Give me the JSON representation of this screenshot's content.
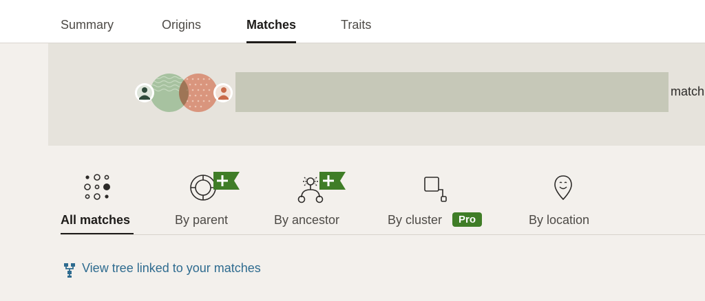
{
  "topnav": {
    "tabs": [
      {
        "label": "Summary"
      },
      {
        "label": "Origins"
      },
      {
        "label": "Matches"
      },
      {
        "label": "Traits"
      }
    ],
    "active": "Matches"
  },
  "banner": {
    "label": "match"
  },
  "filters": {
    "tabs": [
      {
        "label": "All matches",
        "icon": "dots-grid-icon"
      },
      {
        "label": "By parent",
        "icon": "parent-circle-icon"
      },
      {
        "label": "By ancestor",
        "icon": "ancestor-tree-icon"
      },
      {
        "label": "By cluster",
        "icon": "cluster-icon"
      },
      {
        "label": "By location",
        "icon": "location-pin-icon"
      }
    ],
    "active": "All matches",
    "pro_badge": "Pro",
    "plus_badge": "+"
  },
  "link": {
    "label": "View tree linked to your matches",
    "icon": "tree-icon"
  },
  "colors": {
    "accent_green": "#3f7d27",
    "link_blue": "#2e6b8f",
    "banner_bg": "#e6e3dc",
    "banner_bar": "#c6c8b8"
  }
}
